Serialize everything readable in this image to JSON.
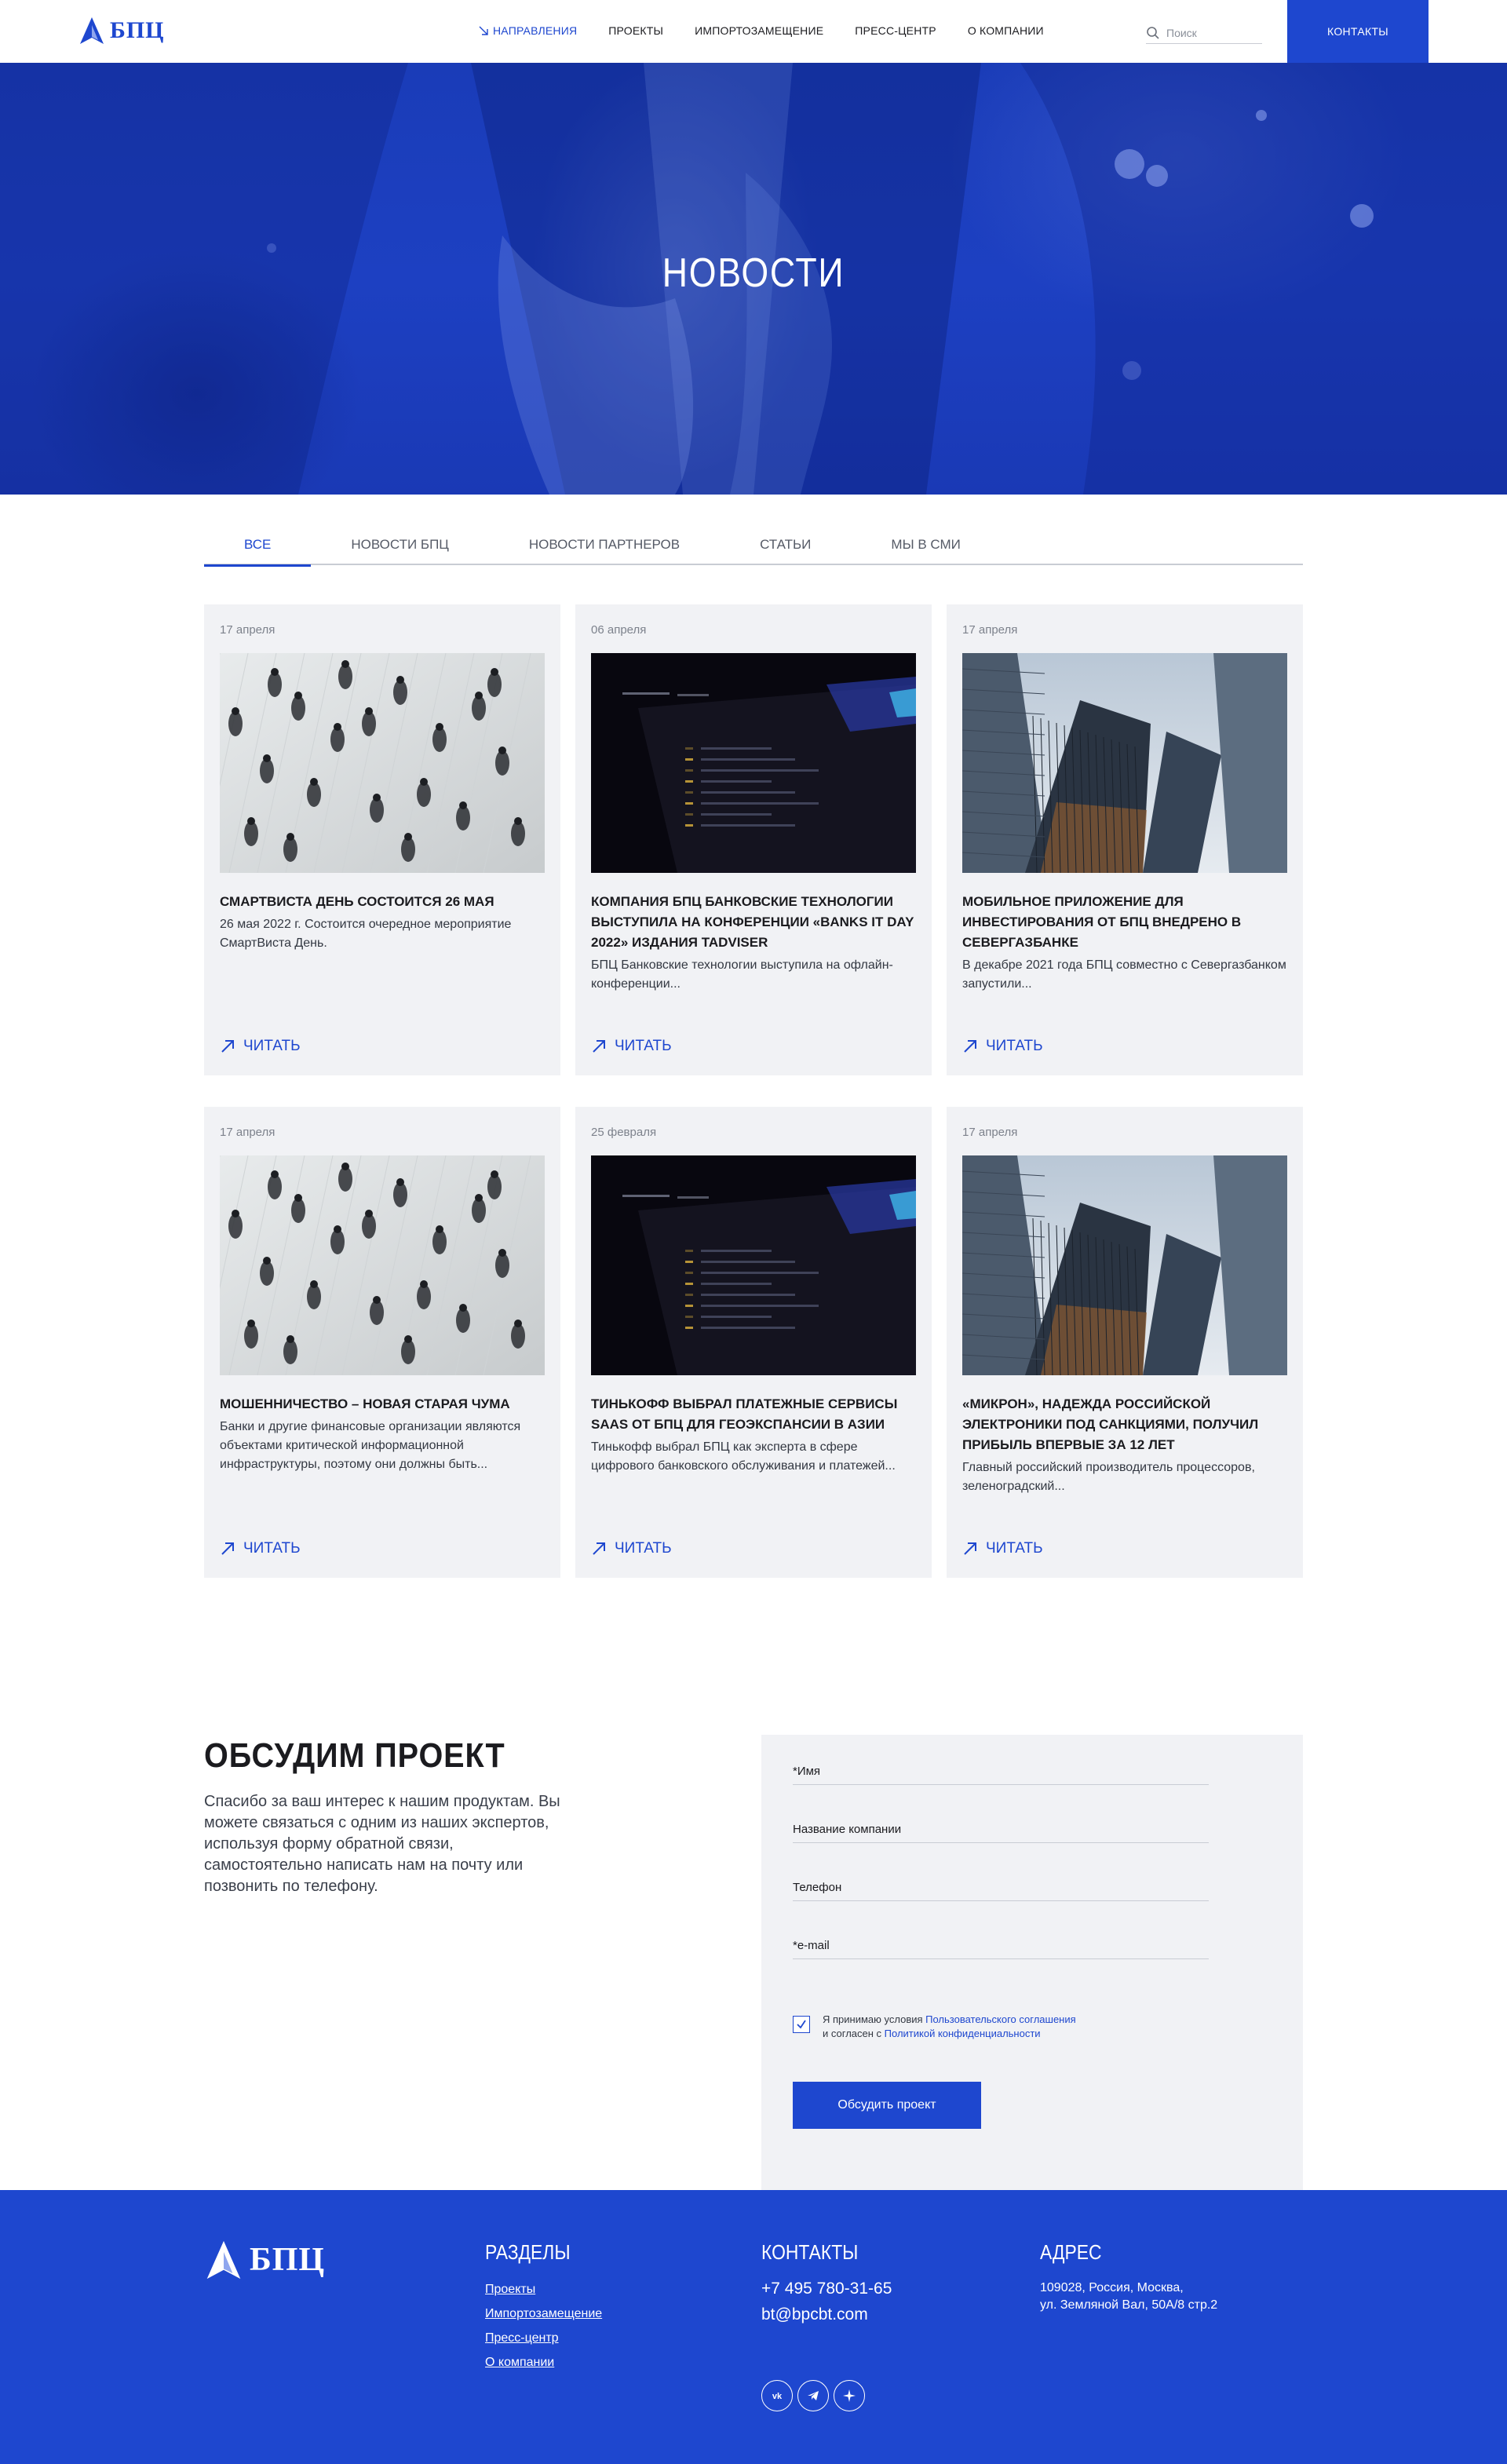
{
  "header": {
    "logo_text": "БПЦ",
    "nav": [
      "Направления",
      "Проекты",
      "Импортозамещение",
      "Пресс-центр",
      "О компании"
    ],
    "search_placeholder": "Поиск",
    "contacts_button": "Контакты"
  },
  "hero": {
    "title": "НОВОСТИ"
  },
  "tabs": [
    "Все",
    "Новости БПЦ",
    "Новости партнеров",
    "Статьи",
    "Мы в СМИ"
  ],
  "active_tab": "Все",
  "cards": [
    {
      "date": "17 апреля",
      "image": "crowd-photo",
      "title": "Смартвиста день состоится 26 мая",
      "text": "26 мая 2022 г. Состоится очередное мероприятие СмартВиста День.",
      "read": "Читать"
    },
    {
      "date": "06 апреля",
      "image": "laptop-photo",
      "title": "Компания БПЦ Банковские технологии выступила на конференции «Banks IT Day 2022» издания TAdviser",
      "text": "БПЦ Банковские технологии выступила на офлайн-конференции...",
      "read": "Читать"
    },
    {
      "date": "17 апреля",
      "image": "skyscrapers-photo",
      "title": "Мобильное приложение для инвестирования от БПЦ внедрено в Севергазбанке",
      "text": "В декабре 2021 года БПЦ совместно с Севергазбанком запустили...",
      "read": "Читать"
    },
    {
      "date": "17 апреля",
      "image": "crowd-photo",
      "title": "Мошенничество – новая старая чума",
      "text": "Банки и другие финансовые организации являются объектами критической информационной инфраструктуры, поэтому они должны быть...",
      "read": "Читать"
    },
    {
      "date": "25 февраля",
      "image": "laptop-photo",
      "title": "Тинькофф выбрал платежные сервисы SaaS от БПЦ для геоэкспансии в Азии",
      "text": "Тинькофф выбрал БПЦ как эксперта в сфере цифрового банковского обслуживания и платежей...",
      "read": "Читать"
    },
    {
      "date": "17 апреля",
      "image": "skyscrapers-photo",
      "title": "«Микрон», надежда российской электроники под санкциями, получил прибыль впервые за 12 лет",
      "text": "Главный российский производитель процессоров, зеленоградский...",
      "read": "Читать"
    }
  ],
  "discuss": {
    "title": "Обсудим проект",
    "text": "Спасибо за ваш интерес к нашим продуктам. Вы можете связаться с одним из наших экспертов, используя форму обратной связи, самостоятельно написать нам на почту или позвонить по телефону.",
    "fields": [
      "*Имя",
      "Название компании",
      "Телефон",
      "*e-mail"
    ],
    "consent_prefix": "Я принимаю условия ",
    "consent_link1": "Пользовательского соглашения",
    "consent_mid": "и согласен с ",
    "consent_link2": "Политикой конфиденциальности",
    "consent_checked": true,
    "submit": "Обсудить проект"
  },
  "footer": {
    "logo_text": "БПЦ",
    "sections_title": "Разделы",
    "sections": [
      "Проекты",
      "Импортозамещение",
      "Пресс-центр",
      "О компании"
    ],
    "contacts_title": "Контакты",
    "phone": "+7 495 780-31-65",
    "email": "bt@bpcbt.com",
    "address_title": "Адрес",
    "address_line1": "109028, Россия, Москва,",
    "address_line2": "ул. Земляной Вал, 50А/8 стр.2",
    "socials": [
      "vk-icon",
      "telegram-icon",
      "spark-icon"
    ]
  },
  "colors": {
    "brand": "#1e47cf",
    "card_bg": "#f1f2f5"
  }
}
